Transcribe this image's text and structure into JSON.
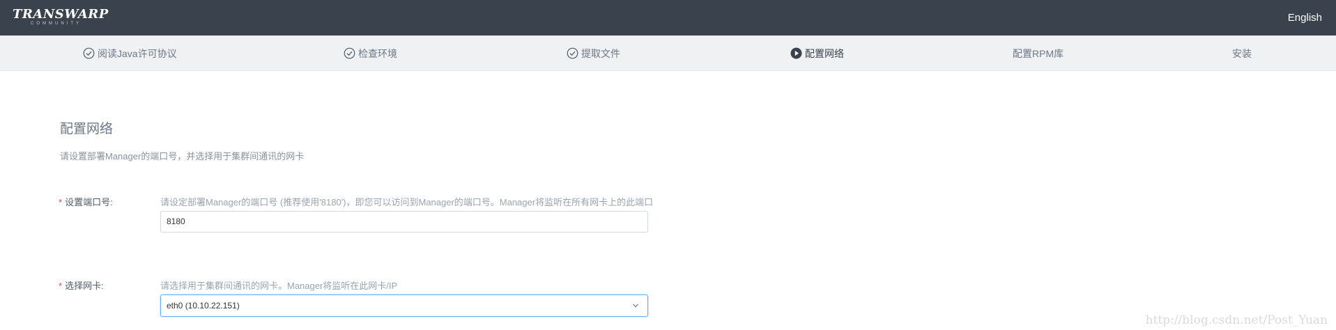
{
  "header": {
    "logo_text": "TRANSWARP",
    "logo_sub": "COMMUNITY",
    "language": "English"
  },
  "steps": [
    {
      "label": "阅读Java许可协议",
      "state": "done"
    },
    {
      "label": "检查环境",
      "state": "done"
    },
    {
      "label": "提取文件",
      "state": "done"
    },
    {
      "label": "配置网络",
      "state": "active"
    },
    {
      "label": "配置RPM库",
      "state": "pending"
    },
    {
      "label": "安装",
      "state": "pending"
    }
  ],
  "main": {
    "title": "配置网络",
    "subtitle": "请设置部署Manager的端口号，并选择用于集群间通讯的网卡",
    "port": {
      "required_mark": "*",
      "label": "设置端口号:",
      "hint": "请设定部署Manager的端口号 (推荐使用'8180')，即您可以访问到Manager的端口号。Manager将监听在所有网卡上的此端口",
      "value": "8180"
    },
    "nic": {
      "required_mark": "*",
      "label": "选择网卡:",
      "hint": "请选择用于集群间通讯的网卡。Manager将监听在此网卡/IP",
      "value": "eth0 (10.10.22.151)"
    }
  },
  "watermark": "http://blog.csdn.net/Post_Yuan",
  "colors": {
    "topbar": "#3a434d",
    "stepbar": "#f0f1f2",
    "required": "#e24a4a",
    "focus": "#66aff0"
  }
}
